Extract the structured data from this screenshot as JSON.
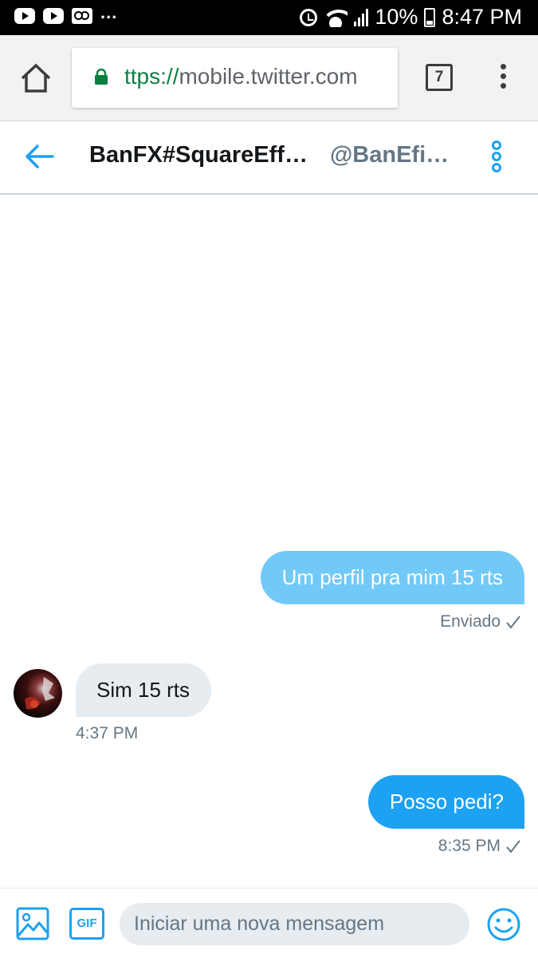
{
  "status_bar": {
    "left_icons": [
      "youtube-icon",
      "youtube-icon",
      "voicemail-icon"
    ],
    "overflow": "...",
    "battery_percent": "10%",
    "time": "8:47 PM"
  },
  "browser": {
    "url_scheme": "ttps://",
    "url_host": "mobile.twitter.com",
    "tab_count": "7"
  },
  "chat_header": {
    "name": "BanFX#SquareEff…",
    "handle": "@BanEfi…"
  },
  "messages": [
    {
      "direction": "outgoing",
      "text": "Um perfil pra mim 15 rts",
      "meta": "Enviado"
    },
    {
      "direction": "incoming",
      "text": "Sim 15 rts",
      "meta": "4:37 PM"
    },
    {
      "direction": "outgoing",
      "text": "Posso pedi?",
      "meta": "8:35 PM"
    }
  ],
  "composer": {
    "gif_label": "GIF",
    "placeholder": "Iniciar uma nova mensagem"
  },
  "colors": {
    "accent": "#1da1f2",
    "pending_bubble": "#71c9f8",
    "incoming_bubble": "#e6ecf0",
    "secure_green": "#0b8043",
    "muted_text": "#657786"
  }
}
